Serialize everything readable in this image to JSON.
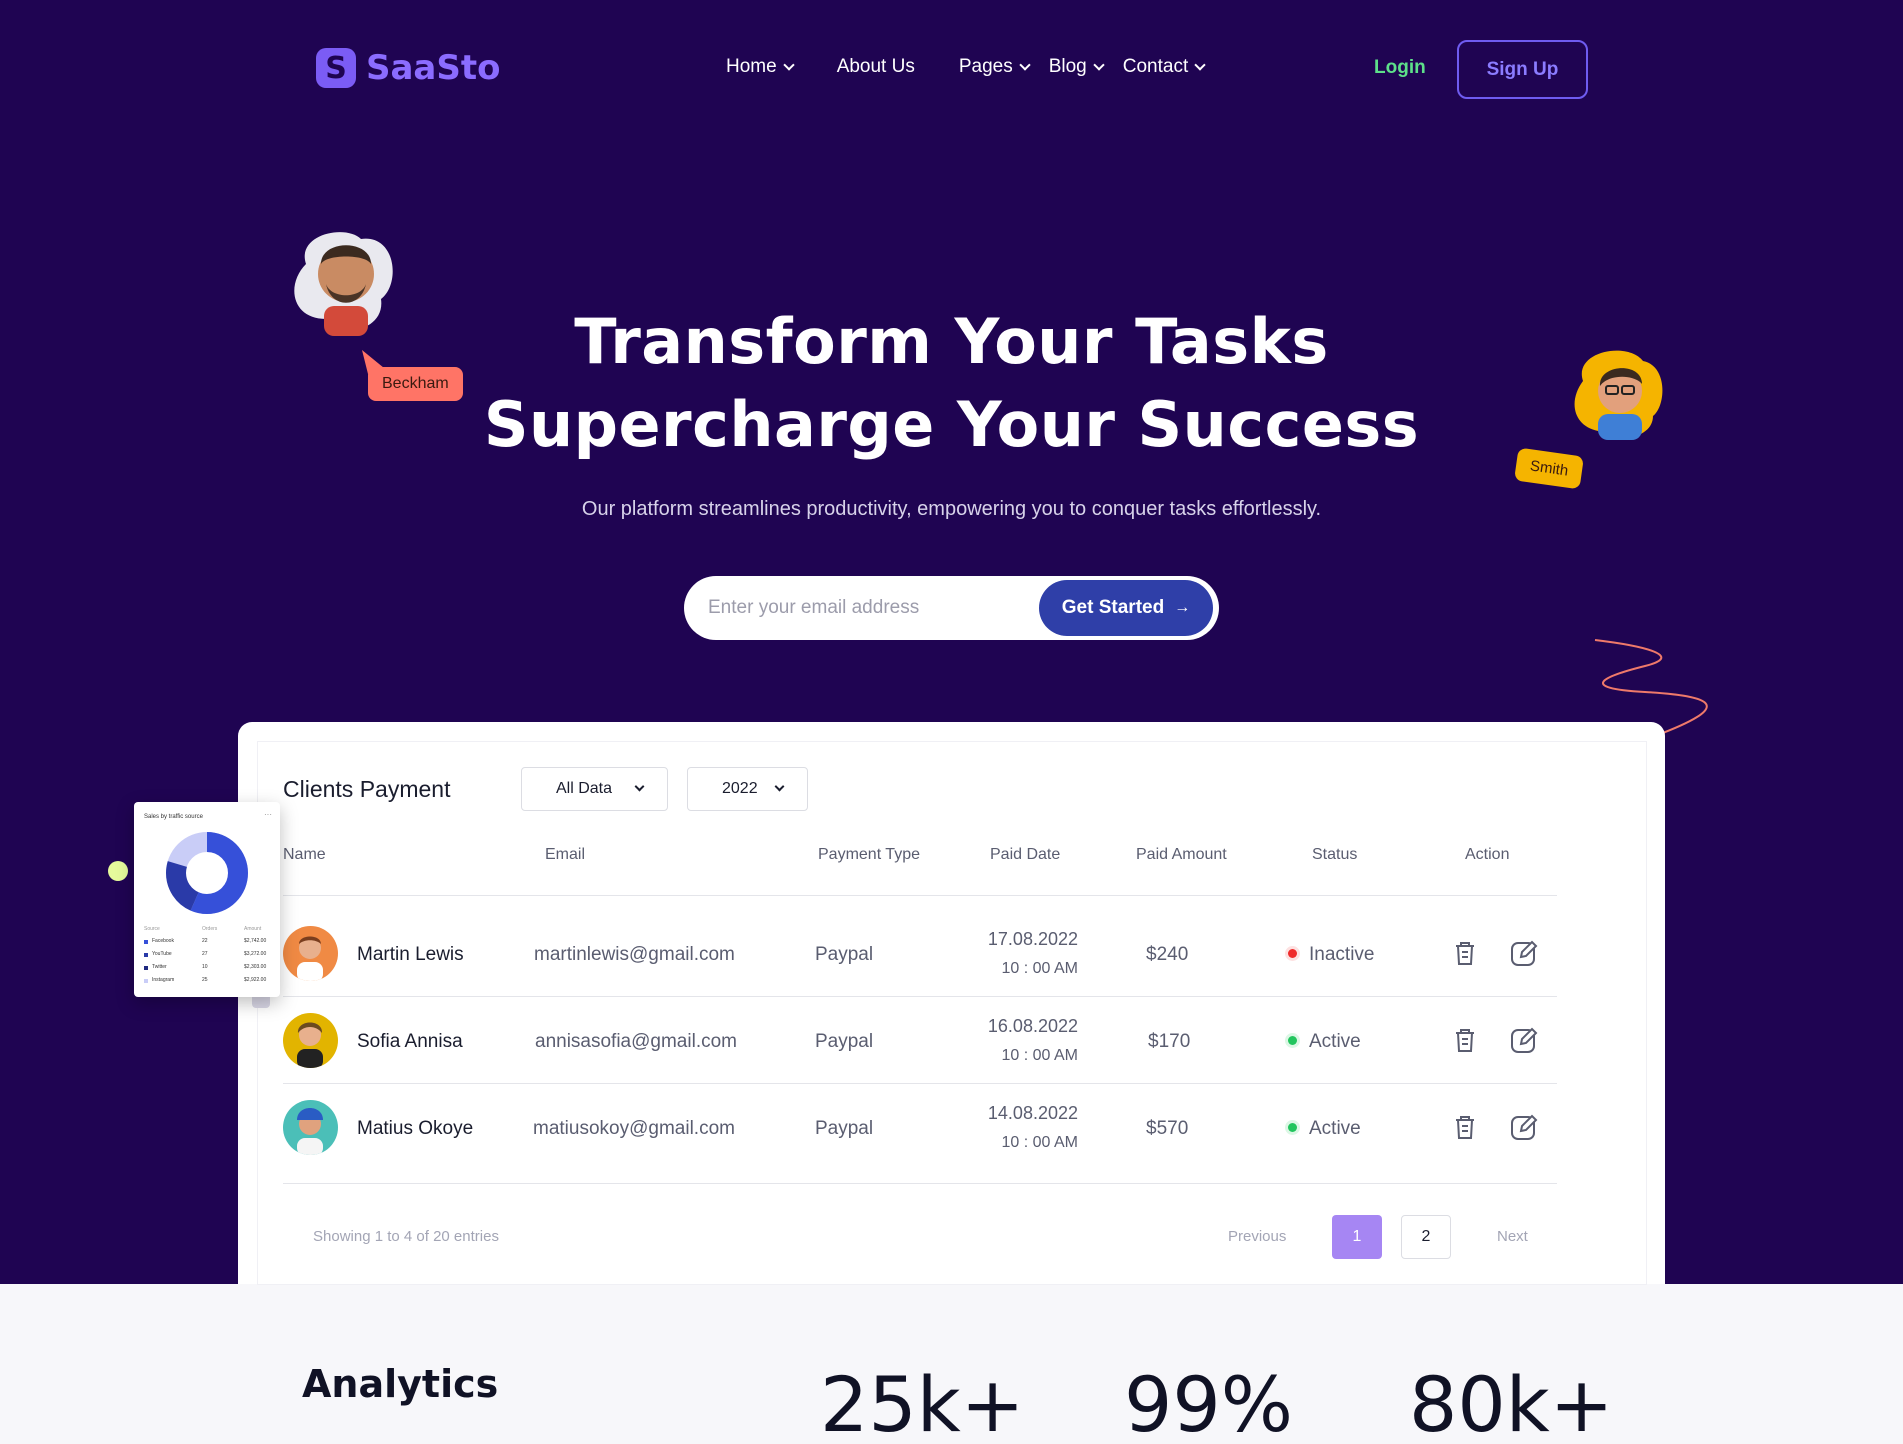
{
  "brand": {
    "name": "SaaSto",
    "mark": "S"
  },
  "nav": {
    "items": [
      {
        "label": "Home",
        "has_dropdown": true
      },
      {
        "label": "About Us",
        "has_dropdown": false
      },
      {
        "label": "Pages",
        "has_dropdown": true
      },
      {
        "label": "Blog",
        "has_dropdown": true
      },
      {
        "label": "Contact",
        "has_dropdown": true
      }
    ],
    "login": "Login",
    "signup": "Sign Up"
  },
  "hero": {
    "title_line1": "Transform Your Tasks",
    "title_line2": "Supercharge Your Success",
    "subtitle": "Our platform streamlines productivity, empowering you to conquer tasks effortlessly.",
    "email_placeholder": "Enter your email address",
    "cta": "Get Started",
    "cta_icon": "arrow-right-icon",
    "avatar_tags": [
      "Beckham",
      "Smith"
    ]
  },
  "dashboard": {
    "title": "Clients Payment",
    "filters": {
      "data": "All Data",
      "year": "2022"
    },
    "columns": [
      "Name",
      "Email",
      "Payment Type",
      "Paid Date",
      "Paid Amount",
      "Status",
      "Action"
    ],
    "rows": [
      {
        "name": "Martin Lewis",
        "email": "martinlewis@gmail.com",
        "payment_type": "Paypal",
        "date": "17.08.2022",
        "time": "10 : 00 AM",
        "amount": "$240",
        "status": "Inactive"
      },
      {
        "name": "Sofia Annisa",
        "email": "annisasofia@gmail.com",
        "payment_type": "Paypal",
        "date": "16.08.2022",
        "time": "10 : 00 AM",
        "amount": "$170",
        "status": "Active"
      },
      {
        "name": "Matius Okoye",
        "email": "matiusokoy@gmail.com",
        "payment_type": "Paypal",
        "date": "14.08.2022",
        "time": "10 : 00 AM",
        "amount": "$570",
        "status": "Active"
      }
    ],
    "footer": "Showing 1 to 4 of 20 entries",
    "pagination": {
      "previous": "Previous",
      "pages": [
        "1",
        "2"
      ],
      "next": "Next"
    }
  },
  "mini_card": {
    "title": "Sales by traffic source",
    "headers": [
      "Source",
      "Orders",
      "Amount"
    ],
    "rows": [
      {
        "source": "Facebook",
        "orders": "22",
        "amount": "$2,742.00"
      },
      {
        "source": "YouTube",
        "orders": "27",
        "amount": "$3,272.00"
      },
      {
        "source": "Twitter",
        "orders": "10",
        "amount": "$2,303.00"
      },
      {
        "source": "Instagram",
        "orders": "25",
        "amount": "$2,922.00"
      }
    ]
  },
  "analytics": {
    "title": "Analytics",
    "stats": [
      "25k+",
      "99%",
      "80k+"
    ]
  },
  "colors": {
    "background": "#1f0452",
    "accent": "#8b6cff",
    "cta": "#2f3fa8",
    "login": "#5de08a",
    "active": "#22c55e",
    "inactive": "#ef2b2b"
  }
}
